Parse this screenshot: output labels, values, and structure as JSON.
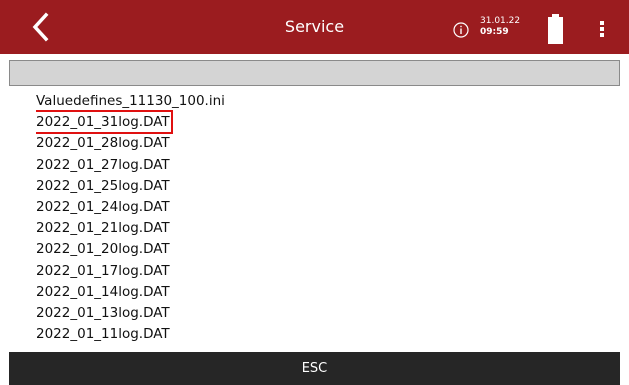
{
  "header": {
    "title": "Service",
    "date": "31.01.22",
    "time": "09:59",
    "icons": [
      "back-arrow-icon",
      "info-icon",
      "battery-icon",
      "more-vertical-icon"
    ],
    "color": "#9b1c1f"
  },
  "pathbar": {
    "value": ""
  },
  "files": [
    "Valuedefines_11130_100.ini",
    "2022_01_31log.DAT",
    "2022_01_28log.DAT",
    "2022_01_27log.DAT",
    "2022_01_25log.DAT",
    "2022_01_24log.DAT",
    "2022_01_21log.DAT",
    "2022_01_20log.DAT",
    "2022_01_17log.DAT",
    "2022_01_14log.DAT",
    "2022_01_13log.DAT",
    "2022_01_11log.DAT"
  ],
  "selected_file": "2022_01_31log.DAT",
  "selection_color": "#e01010",
  "footer": {
    "esc_label": "ESC"
  }
}
